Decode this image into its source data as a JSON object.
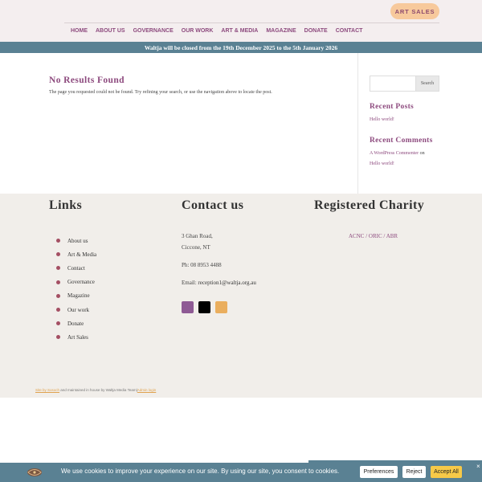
{
  "header": {
    "art_sales_label": "ART SALES",
    "nav": [
      "HOME",
      "ABOUT US",
      "GOVERNANCE",
      "OUR WORK",
      "ART & MEDIA",
      "MAGAZINE",
      "DONATE",
      "CONTACT"
    ]
  },
  "notice": "Waltja will be closed from the 19th December 2025 to the 5th January 2026",
  "content": {
    "title": "No Results Found",
    "text": "The page you requested could not be found. Try refining your search, or use the navigation above to locate the post."
  },
  "sidebar": {
    "search_placeholder": "",
    "search_button": "Search",
    "recent_posts_heading": "Recent Posts",
    "recent_posts": [
      "Hello world!"
    ],
    "recent_comments_heading": "Recent Comments",
    "comment_author": "A WordPress Commenter",
    "comment_on": "on",
    "comment_post": "Hello world!"
  },
  "footer": {
    "links_heading": "Links",
    "links": [
      "About us",
      "Art & Media",
      "Contact",
      "Governance",
      "Magazine",
      "Our work",
      "Donate",
      "Art Sales"
    ],
    "contact_heading": "Contact us",
    "address_line1": "3 Ghan Road,",
    "address_line2": "Ciccone, NT",
    "phone": "Ph: 08 8953 4488",
    "email_label": "Email:",
    "email": "reception1@waltja.org.au",
    "charity_heading": "Registered Charity",
    "charity_acnc": "ACNC",
    "charity_sep1": " / ",
    "charity_oric": "ORIC",
    "charity_sep2": " / ",
    "charity_abr": "ABR",
    "credit_link1": "Site by Sosoch",
    "credit_text": " and maintained in house by Waltja Media Team|",
    "credit_link2": "Admin login"
  },
  "social_colors": {
    "first": "#8e5a94",
    "second": "#000000",
    "third": "#eaae5e"
  },
  "cookie": {
    "text": "We use cookies to improve your experience on our site. By using our site, you consent to cookies.",
    "preferences": "Preferences",
    "reject": "Reject",
    "accept": "Accept All",
    "close": "×"
  }
}
